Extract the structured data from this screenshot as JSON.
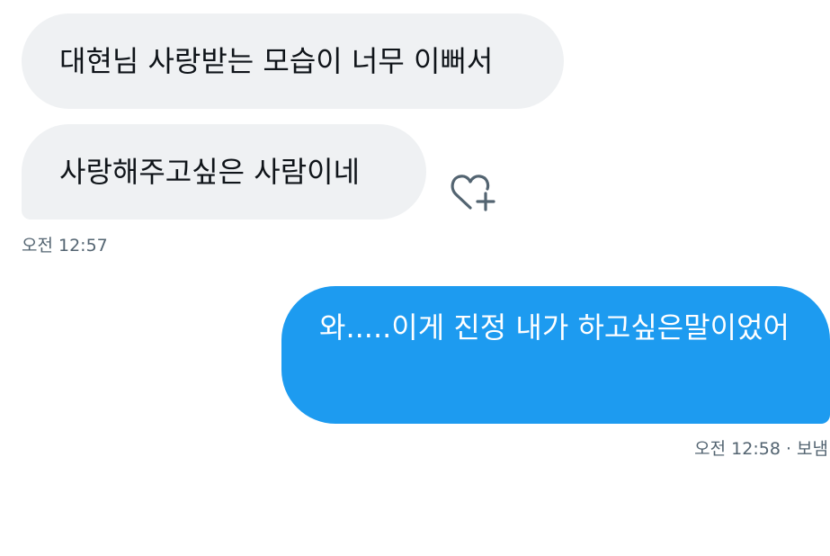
{
  "received": {
    "messages": [
      {
        "text": "대현님 사랑받는 모습이 너무 이뻐서"
      },
      {
        "text": "사랑해주고싶은 사람이네"
      }
    ],
    "timestamp": "오전 12:57"
  },
  "sent": {
    "messages": [
      {
        "text": "와.....이게 진정 내가 하고싶은말이었어"
      }
    ],
    "timestamp": "오전 12:58 · 보냄"
  },
  "colors": {
    "received_bubble": "#eff1f3",
    "sent_bubble": "#1d9bf0",
    "timestamp_text": "#536471"
  },
  "icons": {
    "react": "heart-plus-icon"
  }
}
